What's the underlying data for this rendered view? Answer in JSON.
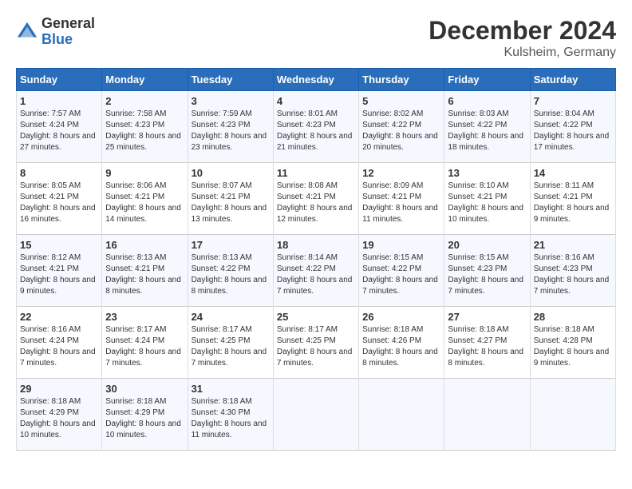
{
  "logo": {
    "general": "General",
    "blue": "Blue"
  },
  "title": "December 2024",
  "location": "Kulsheim, Germany",
  "days_of_week": [
    "Sunday",
    "Monday",
    "Tuesday",
    "Wednesday",
    "Thursday",
    "Friday",
    "Saturday"
  ],
  "weeks": [
    [
      {
        "day": "1",
        "sunrise": "Sunrise: 7:57 AM",
        "sunset": "Sunset: 4:24 PM",
        "daylight": "Daylight: 8 hours and 27 minutes."
      },
      {
        "day": "2",
        "sunrise": "Sunrise: 7:58 AM",
        "sunset": "Sunset: 4:23 PM",
        "daylight": "Daylight: 8 hours and 25 minutes."
      },
      {
        "day": "3",
        "sunrise": "Sunrise: 7:59 AM",
        "sunset": "Sunset: 4:23 PM",
        "daylight": "Daylight: 8 hours and 23 minutes."
      },
      {
        "day": "4",
        "sunrise": "Sunrise: 8:01 AM",
        "sunset": "Sunset: 4:23 PM",
        "daylight": "Daylight: 8 hours and 21 minutes."
      },
      {
        "day": "5",
        "sunrise": "Sunrise: 8:02 AM",
        "sunset": "Sunset: 4:22 PM",
        "daylight": "Daylight: 8 hours and 20 minutes."
      },
      {
        "day": "6",
        "sunrise": "Sunrise: 8:03 AM",
        "sunset": "Sunset: 4:22 PM",
        "daylight": "Daylight: 8 hours and 18 minutes."
      },
      {
        "day": "7",
        "sunrise": "Sunrise: 8:04 AM",
        "sunset": "Sunset: 4:22 PM",
        "daylight": "Daylight: 8 hours and 17 minutes."
      }
    ],
    [
      {
        "day": "8",
        "sunrise": "Sunrise: 8:05 AM",
        "sunset": "Sunset: 4:21 PM",
        "daylight": "Daylight: 8 hours and 16 minutes."
      },
      {
        "day": "9",
        "sunrise": "Sunrise: 8:06 AM",
        "sunset": "Sunset: 4:21 PM",
        "daylight": "Daylight: 8 hours and 14 minutes."
      },
      {
        "day": "10",
        "sunrise": "Sunrise: 8:07 AM",
        "sunset": "Sunset: 4:21 PM",
        "daylight": "Daylight: 8 hours and 13 minutes."
      },
      {
        "day": "11",
        "sunrise": "Sunrise: 8:08 AM",
        "sunset": "Sunset: 4:21 PM",
        "daylight": "Daylight: 8 hours and 12 minutes."
      },
      {
        "day": "12",
        "sunrise": "Sunrise: 8:09 AM",
        "sunset": "Sunset: 4:21 PM",
        "daylight": "Daylight: 8 hours and 11 minutes."
      },
      {
        "day": "13",
        "sunrise": "Sunrise: 8:10 AM",
        "sunset": "Sunset: 4:21 PM",
        "daylight": "Daylight: 8 hours and 10 minutes."
      },
      {
        "day": "14",
        "sunrise": "Sunrise: 8:11 AM",
        "sunset": "Sunset: 4:21 PM",
        "daylight": "Daylight: 8 hours and 9 minutes."
      }
    ],
    [
      {
        "day": "15",
        "sunrise": "Sunrise: 8:12 AM",
        "sunset": "Sunset: 4:21 PM",
        "daylight": "Daylight: 8 hours and 9 minutes."
      },
      {
        "day": "16",
        "sunrise": "Sunrise: 8:13 AM",
        "sunset": "Sunset: 4:21 PM",
        "daylight": "Daylight: 8 hours and 8 minutes."
      },
      {
        "day": "17",
        "sunrise": "Sunrise: 8:13 AM",
        "sunset": "Sunset: 4:22 PM",
        "daylight": "Daylight: 8 hours and 8 minutes."
      },
      {
        "day": "18",
        "sunrise": "Sunrise: 8:14 AM",
        "sunset": "Sunset: 4:22 PM",
        "daylight": "Daylight: 8 hours and 7 minutes."
      },
      {
        "day": "19",
        "sunrise": "Sunrise: 8:15 AM",
        "sunset": "Sunset: 4:22 PM",
        "daylight": "Daylight: 8 hours and 7 minutes."
      },
      {
        "day": "20",
        "sunrise": "Sunrise: 8:15 AM",
        "sunset": "Sunset: 4:23 PM",
        "daylight": "Daylight: 8 hours and 7 minutes."
      },
      {
        "day": "21",
        "sunrise": "Sunrise: 8:16 AM",
        "sunset": "Sunset: 4:23 PM",
        "daylight": "Daylight: 8 hours and 7 minutes."
      }
    ],
    [
      {
        "day": "22",
        "sunrise": "Sunrise: 8:16 AM",
        "sunset": "Sunset: 4:24 PM",
        "daylight": "Daylight: 8 hours and 7 minutes."
      },
      {
        "day": "23",
        "sunrise": "Sunrise: 8:17 AM",
        "sunset": "Sunset: 4:24 PM",
        "daylight": "Daylight: 8 hours and 7 minutes."
      },
      {
        "day": "24",
        "sunrise": "Sunrise: 8:17 AM",
        "sunset": "Sunset: 4:25 PM",
        "daylight": "Daylight: 8 hours and 7 minutes."
      },
      {
        "day": "25",
        "sunrise": "Sunrise: 8:17 AM",
        "sunset": "Sunset: 4:25 PM",
        "daylight": "Daylight: 8 hours and 7 minutes."
      },
      {
        "day": "26",
        "sunrise": "Sunrise: 8:18 AM",
        "sunset": "Sunset: 4:26 PM",
        "daylight": "Daylight: 8 hours and 8 minutes."
      },
      {
        "day": "27",
        "sunrise": "Sunrise: 8:18 AM",
        "sunset": "Sunset: 4:27 PM",
        "daylight": "Daylight: 8 hours and 8 minutes."
      },
      {
        "day": "28",
        "sunrise": "Sunrise: 8:18 AM",
        "sunset": "Sunset: 4:28 PM",
        "daylight": "Daylight: 8 hours and 9 minutes."
      }
    ],
    [
      {
        "day": "29",
        "sunrise": "Sunrise: 8:18 AM",
        "sunset": "Sunset: 4:29 PM",
        "daylight": "Daylight: 8 hours and 10 minutes."
      },
      {
        "day": "30",
        "sunrise": "Sunrise: 8:18 AM",
        "sunset": "Sunset: 4:29 PM",
        "daylight": "Daylight: 8 hours and 10 minutes."
      },
      {
        "day": "31",
        "sunrise": "Sunrise: 8:18 AM",
        "sunset": "Sunset: 4:30 PM",
        "daylight": "Daylight: 8 hours and 11 minutes."
      },
      null,
      null,
      null,
      null
    ]
  ]
}
